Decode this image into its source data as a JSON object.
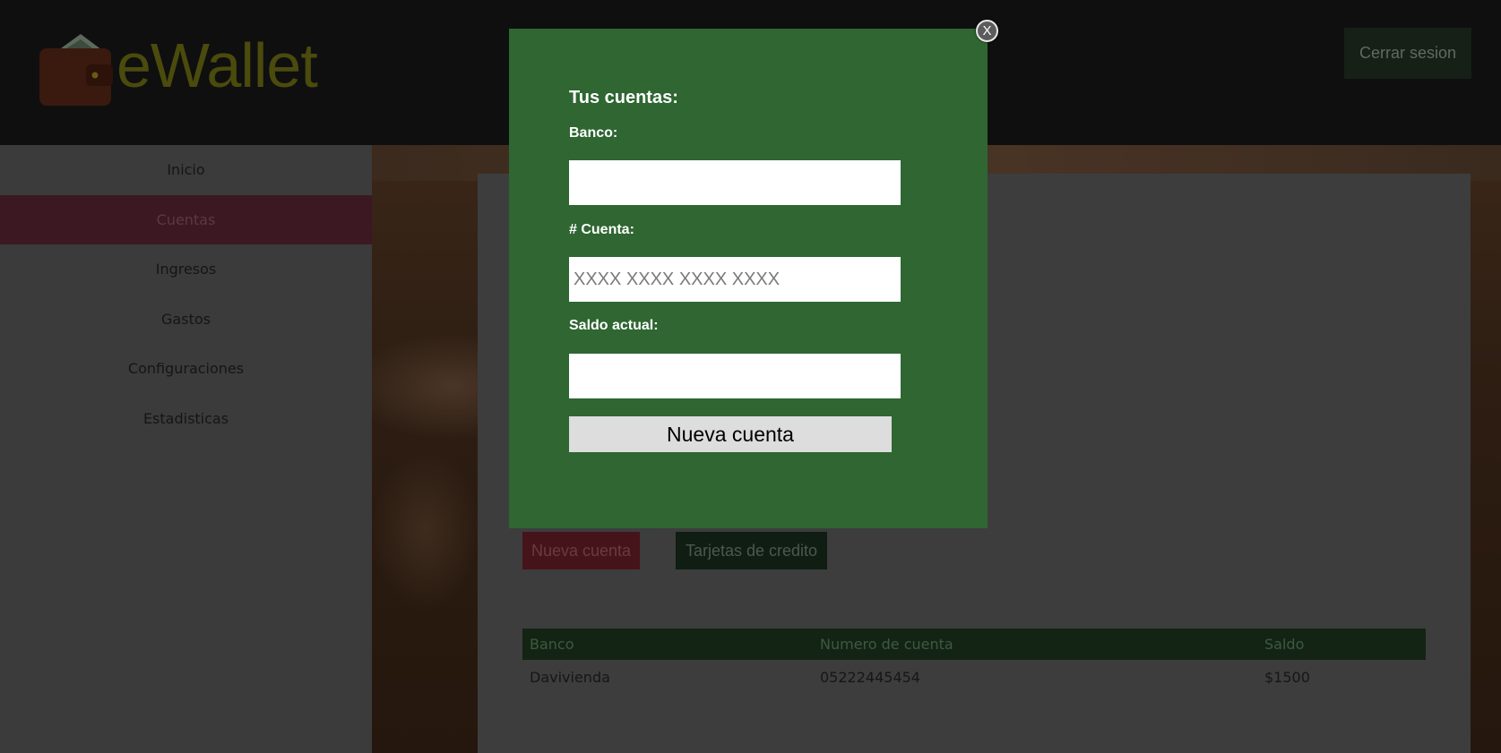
{
  "header": {
    "logo_text": "eWallet",
    "logout_label": "Cerrar sesion"
  },
  "sidebar": {
    "items": [
      {
        "label": "Inicio",
        "active": false
      },
      {
        "label": "Cuentas",
        "active": true
      },
      {
        "label": "Ingresos",
        "active": false
      },
      {
        "label": "Gastos",
        "active": false
      },
      {
        "label": "Configuraciones",
        "active": false
      },
      {
        "label": "Estadisticas",
        "active": false
      }
    ]
  },
  "main": {
    "new_account_label": "Nueva cuenta",
    "cards_label": "Tarjetas de credito",
    "table": {
      "headers": [
        "Banco",
        "Numero de cuenta",
        "Saldo"
      ],
      "rows": [
        [
          "Davivienda",
          "05222445454",
          "$1500"
        ]
      ]
    }
  },
  "modal": {
    "title": "Tus cuentas:",
    "bank_label": "Banco:",
    "bank_value": "",
    "account_label": "# Cuenta:",
    "account_placeholder": "XXXX XXXX XXXX XXXX",
    "balance_label": "Saldo actual:",
    "balance_value": "",
    "submit_label": "Nueva cuenta",
    "close_label": "X"
  },
  "colors": {
    "modal_bg": "#2f6632",
    "active_nav": "#3c1822",
    "logo": "#4a4b0c"
  },
  "icons": {
    "logo": "wallet-icon",
    "close": "close-icon"
  }
}
